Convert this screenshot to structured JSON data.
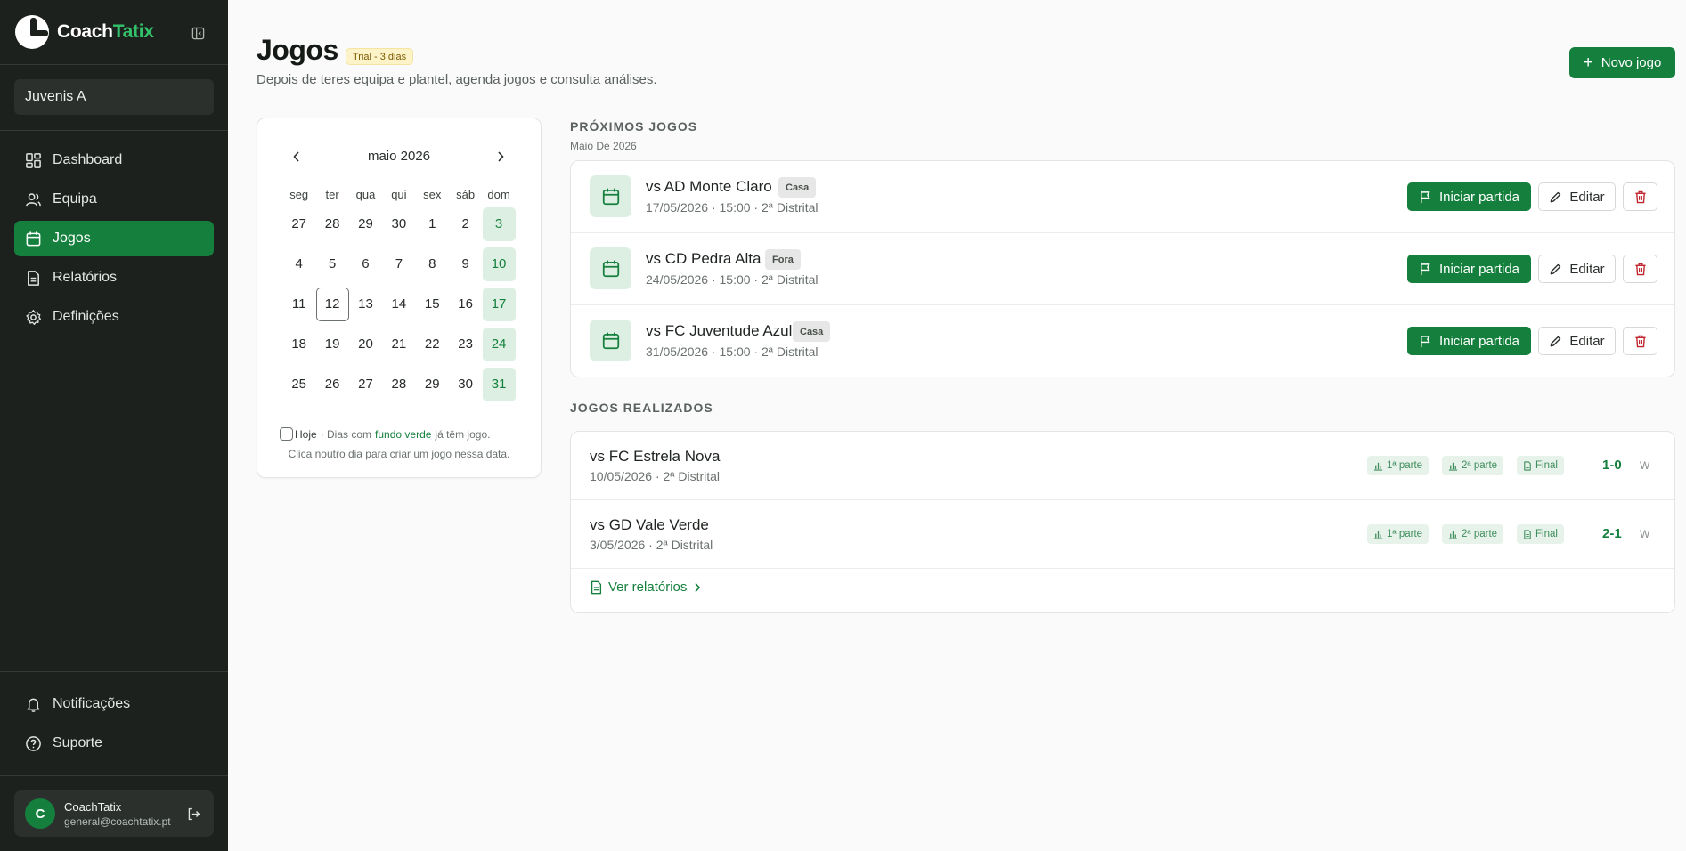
{
  "brand": {
    "name_part1": "Coach",
    "name_part2": "Tatix"
  },
  "team": {
    "selected": "Juvenis A"
  },
  "nav": [
    {
      "label": "Dashboard",
      "icon": "dashboard-icon"
    },
    {
      "label": "Equipa",
      "icon": "users-icon"
    },
    {
      "label": "Jogos",
      "icon": "calendar-icon",
      "active": true
    },
    {
      "label": "Relatórios",
      "icon": "document-icon"
    },
    {
      "label": "Definições",
      "icon": "gear-icon"
    }
  ],
  "nav_bottom": [
    {
      "label": "Notificações",
      "icon": "bell-icon"
    },
    {
      "label": "Suporte",
      "icon": "help-icon"
    }
  ],
  "user": {
    "initial": "C",
    "name": "CoachTatix",
    "email": "general@coachtatix.pt"
  },
  "header": {
    "title": "Jogos",
    "trial_badge": "Trial - 3 dias",
    "subtitle": "Depois de teres equipa e plantel, agenda jogos e consulta análises.",
    "new_game_label": "Novo jogo"
  },
  "calendar": {
    "month_label": "maio 2026",
    "weekdays": [
      "seg",
      "ter",
      "qua",
      "qui",
      "sex",
      "sáb",
      "dom"
    ],
    "weeks": [
      [
        "27",
        "28",
        "29",
        "30",
        "1",
        "2",
        "3"
      ],
      [
        "4",
        "5",
        "6",
        "7",
        "8",
        "9",
        "10"
      ],
      [
        "11",
        "12",
        "13",
        "14",
        "15",
        "16",
        "17"
      ],
      [
        "18",
        "19",
        "20",
        "21",
        "22",
        "23",
        "24"
      ],
      [
        "25",
        "26",
        "27",
        "28",
        "29",
        "30",
        "31"
      ]
    ],
    "game_days": [
      "3",
      "10",
      "17",
      "24",
      "31"
    ],
    "today": "12",
    "legend_today": "Hoje",
    "legend_pre": "· Dias com",
    "legend_green": "fundo verde",
    "legend_post": "já têm jogo.",
    "legend_line2": "Clica noutro dia para criar um jogo nessa data."
  },
  "upcoming": {
    "title": "PRÓXIMOS JOGOS",
    "subtitle": "Maio De 2026",
    "start_label": "Iniciar partida",
    "edit_label": "Editar",
    "games": [
      {
        "opponent": "vs AD Monte Claro",
        "tag": "Casa",
        "meta": "17/05/2026 · 15:00 · 2ª Distrital"
      },
      {
        "opponent": "vs CD Pedra Alta",
        "tag": "Fora",
        "meta": "24/05/2026 · 15:00 · 2ª Distrital"
      },
      {
        "opponent": "vs FC Juventude Azul",
        "tag": "Casa",
        "meta": "31/05/2026 · 15:00 · 2ª Distrital"
      }
    ]
  },
  "played": {
    "title": "JOGOS REALIZADOS",
    "chip_first": "1ª parte",
    "chip_second": "2ª parte",
    "chip_final": "Final",
    "games": [
      {
        "opponent": "vs FC Estrela Nova",
        "meta": "10/05/2026 · 2ª Distrital",
        "score": "1-0",
        "result": "W"
      },
      {
        "opponent": "vs GD Vale Verde",
        "meta": "3/05/2026 · 2ª Distrital",
        "score": "2-1",
        "result": "W"
      }
    ],
    "reports_link": "Ver relatórios"
  },
  "colors": {
    "accent": "#15803d",
    "sidebar_bg": "#1d211e",
    "game_day_bg": "#dcefe2",
    "brand_green": "#33c26b"
  }
}
